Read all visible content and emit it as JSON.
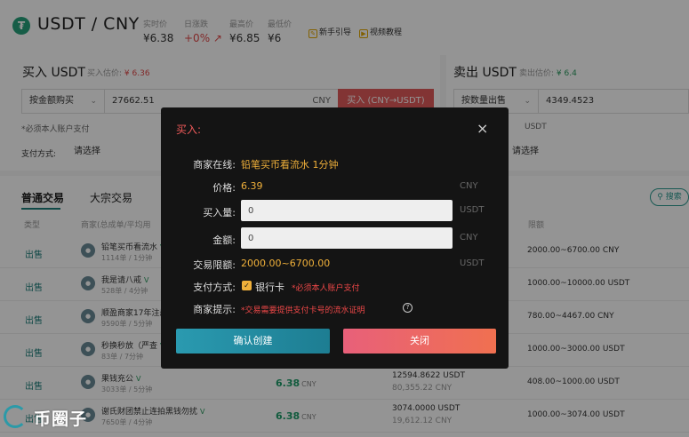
{
  "header": {
    "pair": "USDT / CNY",
    "stats": [
      {
        "label": "实时价",
        "value": "¥6.38"
      },
      {
        "label": "日涨跌",
        "value": "+0% ↗"
      },
      {
        "label": "最高价",
        "value": "¥6.85"
      },
      {
        "label": "最低价",
        "value": "¥6"
      }
    ],
    "guide_new": "新手引导",
    "guide_video": "视频教程"
  },
  "buy_panel": {
    "title": "买入 USDT",
    "est_label": "买入估价:",
    "est_value": "¥ 6.36",
    "mode": "按金额购买",
    "amount": "27662.51",
    "unit": "CNY",
    "buy_button": "买入 (CNY→USDT)",
    "note": "*必须本人账户支付",
    "pay_label": "支付方式:",
    "pay_placeholder": "请选择"
  },
  "sell_panel": {
    "title": "卖出 USDT",
    "est_label": "卖出估价:",
    "est_value": "¥ 6.4",
    "mode": "按数量出售",
    "amount": "4349.4523",
    "unit": "USDT",
    "unit2": "USDT",
    "pay_placeholder": "请选择"
  },
  "tabs": {
    "normal": "普通交易",
    "bulk": "大宗交易",
    "search": "搜索"
  },
  "table": {
    "headers": {
      "type": "类型",
      "merchant": "商家(总成单/平均用",
      "limit": "限额"
    },
    "rows": [
      {
        "type": "出售",
        "name": "铅笔买币看流水",
        "stat": "1114单 / 1分钟",
        "price": "",
        "qty": "",
        "amt": "",
        "limit": "2000.00~6700.00 CNY"
      },
      {
        "type": "出售",
        "name": "我是请八戒",
        "stat": "528单 / 4分钟",
        "price": "",
        "qty": "",
        "amt": "",
        "limit": "1000.00~10000.00 USDT"
      },
      {
        "type": "出售",
        "name": "顺盈商家17年注册",
        "stat": "9590单 / 5分钟",
        "price": "",
        "qty": "",
        "amt": "",
        "limit": "780.00~4467.00 CNY"
      },
      {
        "type": "出售",
        "name": "秒换秒放（严查",
        "stat": "83单 / 7分钟",
        "price": "",
        "qty": "",
        "amt": "",
        "limit": "1000.00~3000.00 USDT"
      },
      {
        "type": "出售",
        "name": "果钱充公",
        "stat": "3033单 / 5分钟",
        "price": "6.38",
        "price_unit": "CNY",
        "qty": "12594.8622 USDT",
        "amt": "80,355.22 CNY",
        "limit": "408.00~1000.00 USDT"
      },
      {
        "type": "出售",
        "name": "谢氏财团禁止连拍黑钱勿扰",
        "stat": "7650单 / 4分钟",
        "price": "6.38",
        "price_unit": "CNY",
        "qty": "3074.0000 USDT",
        "amt": "19,612.12 CNY",
        "limit": "1000.00~3074.00 USDT"
      }
    ]
  },
  "modal": {
    "title": "买入:",
    "merchant_label": "商家在线:",
    "merchant_value": "铅笔买币看流水 1分钟",
    "price_label": "价格:",
    "price_value": "6.39",
    "price_unit": "CNY",
    "buy_qty_label": "买入量:",
    "buy_qty_value": "0",
    "buy_qty_unit": "USDT",
    "amount_label": "金额:",
    "amount_value": "0",
    "amount_unit": "CNY",
    "limit_label": "交易限额:",
    "limit_value": "2000.00~6700.00",
    "limit_unit": "USDT",
    "pay_label": "支付方式:",
    "pay_value": "银行卡",
    "pay_note": "*必须本人账户支付",
    "tip_label": "商家提示:",
    "tip_value": "*交易需要提供支付卡号的流水证明",
    "confirm_button": "确认创建",
    "close_button": "关闭"
  },
  "watermark": "币圈子",
  "colors": {
    "accent": "#1e7f7a",
    "buy": "#e05a5a",
    "modal_bg": "#141414",
    "highlight": "#f0b03a"
  }
}
